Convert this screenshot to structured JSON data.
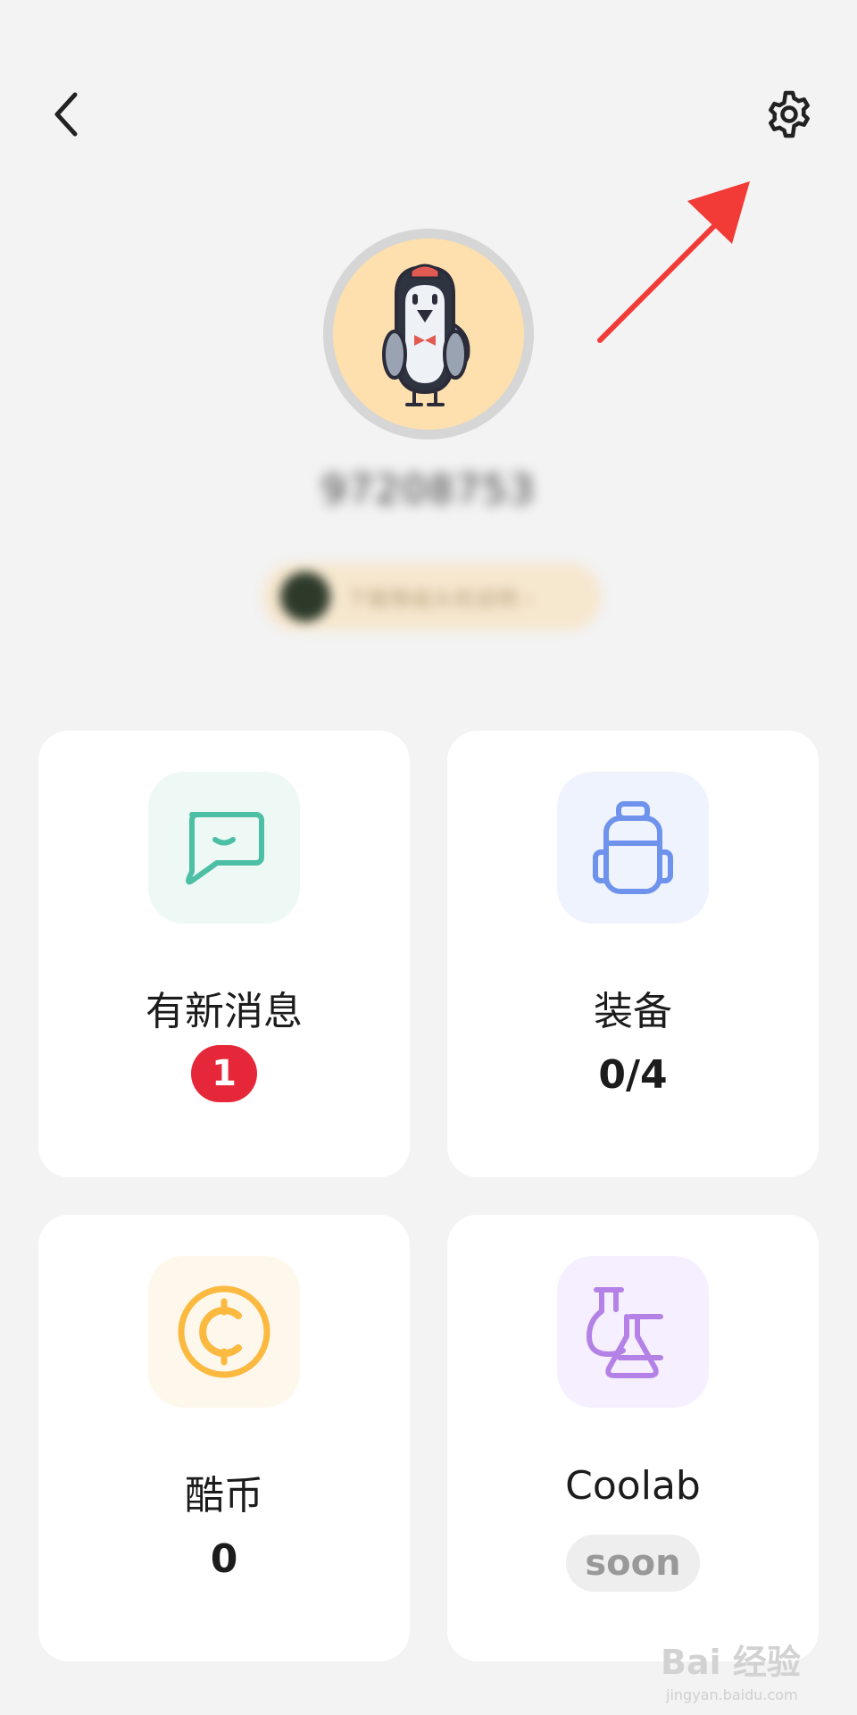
{
  "header": {
    "back_icon": "chevron-left-icon",
    "settings_icon": "gear-icon"
  },
  "profile": {
    "username": "97208753",
    "level_text": "下载等级头衔说明 ›"
  },
  "cards": [
    {
      "title": "有新消息",
      "badge": "1",
      "icon": "message-icon",
      "icon_bg": "#eef9f6",
      "icon_color": "#4dbfa4"
    },
    {
      "title": "装备",
      "value": "0/4",
      "icon": "backpack-icon",
      "icon_bg": "#eef3fe",
      "icon_color": "#6f92ec"
    },
    {
      "title": "酷币",
      "value": "0",
      "icon": "coin-icon",
      "icon_bg": "#fef7ec",
      "icon_color": "#fbb940"
    },
    {
      "title": "Coolab",
      "tag": "soon",
      "icon": "flask-icon",
      "icon_bg": "#f6efff",
      "icon_color": "#b482e6"
    }
  ],
  "colors": {
    "background": "#f3f3f3",
    "annotation_arrow": "#f23a36",
    "badge": "#e6273a",
    "avatar_bg": "#fde0ad"
  },
  "watermark": {
    "main": "Bai 经验",
    "sub": "jingyan.baidu.com"
  }
}
